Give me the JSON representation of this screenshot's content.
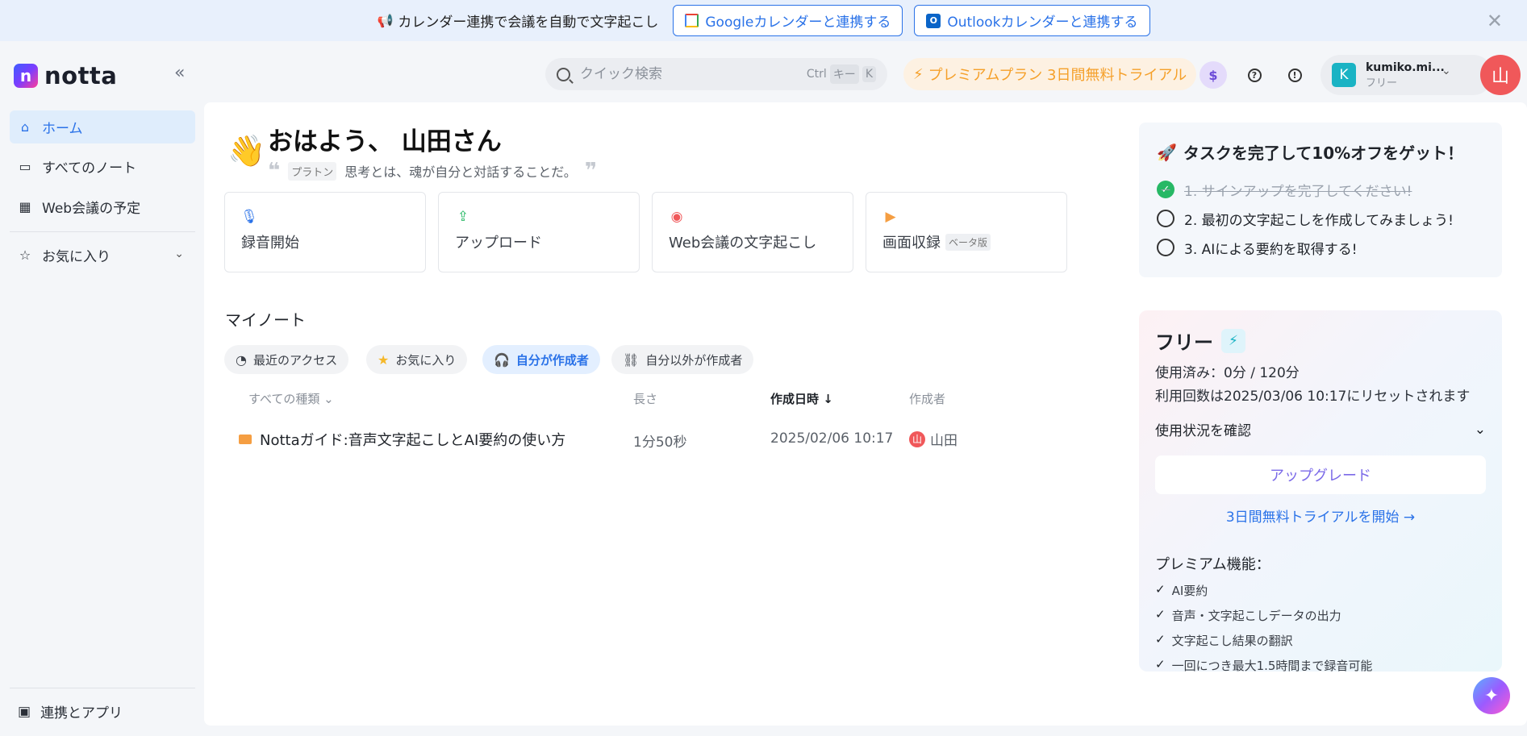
{
  "banner": {
    "text": "カレンダー連携で会議を自動で文字起こし",
    "google_button": "Googleカレンダーと連携する",
    "outlook_button": "Outlookカレンダーと連携する",
    "outlook_icon_letter": "O"
  },
  "header": {
    "logo_mark": "n",
    "logo_text": "notta",
    "search_placeholder": "クイック検索",
    "search_shortcut_ctrl": "Ctrl",
    "search_shortcut_key_label": "キー",
    "search_shortcut_key": "K",
    "premium_label": "プレミアムプラン 3日間無料トライアル",
    "user_name": "kumiko.mi...",
    "user_plan": "フリー",
    "user_initial": "K",
    "avatar_initial": "山"
  },
  "sidebar": {
    "items": [
      {
        "label": "ホーム",
        "icon": "home-icon"
      },
      {
        "label": "すべてのノート",
        "icon": "folder-icon"
      },
      {
        "label": "Web会議の予定",
        "icon": "calendar-icon"
      },
      {
        "label": "お気に入り",
        "icon": "star-icon"
      }
    ],
    "bottom_link": "連携とアプリ"
  },
  "greeting": {
    "title": "おはよう、 山田さん",
    "quote_author": "プラトン",
    "quote_text": "思考とは、魂が自分と対話することだ。"
  },
  "actions": [
    {
      "label": "録音開始",
      "icon": "microphone-icon",
      "color": "#2a72e8"
    },
    {
      "label": "アップロード",
      "icon": "upload-icon",
      "color": "#27b865"
    },
    {
      "label": "Web会議の文字起こし",
      "icon": "bot-icon",
      "color": "#f0585a"
    },
    {
      "label": "画面収録",
      "icon": "video-icon",
      "color": "#f59e42",
      "badge": "ベータ版"
    }
  ],
  "notes": {
    "section_title": "マイノート",
    "filters": [
      "最近のアクセス",
      "お気に入り",
      "自分が作成者",
      "自分以外が作成者"
    ],
    "active_filter": "自分が作成者",
    "columns": {
      "type": "すべての種類",
      "length": "長さ",
      "created": "作成日時",
      "author": "作成者"
    },
    "rows": [
      {
        "title": "Nottaガイド:音声文字起こしとAI要約の使い方",
        "length": "1分50秒",
        "created": "2025/02/06 10:17",
        "author": "山田",
        "author_initial": "山"
      }
    ]
  },
  "tasks": {
    "title": "タスクを完了して10%オフをゲット！",
    "items": [
      {
        "label": "1. サインアップを完了してください!",
        "done": true
      },
      {
        "label": "2. 最初の文字起こしを作成してみましょう!",
        "done": false
      },
      {
        "label": "3. AIによる要約を取得する!",
        "done": false
      }
    ]
  },
  "plan": {
    "title": "フリー",
    "usage": "使用済み：0分 / 120分",
    "reset": "利用回数は2025/03/06 10:17にリセットされます",
    "usage_toggle": "使用状況を確認",
    "upgrade": "アップグレード",
    "trial": "3日間無料トライアルを開始 →",
    "features_title": "プレミアム機能：",
    "features": [
      "AI要約",
      "音声・文字起こしデータの出力",
      "文字起こし結果の翻訳",
      "一回につき最大1.5時間まで録音可能"
    ]
  },
  "colors": {
    "accent": "#2a72e8",
    "premium": "#f5a02a",
    "avatar": "#f0585a",
    "done": "#27b865"
  }
}
